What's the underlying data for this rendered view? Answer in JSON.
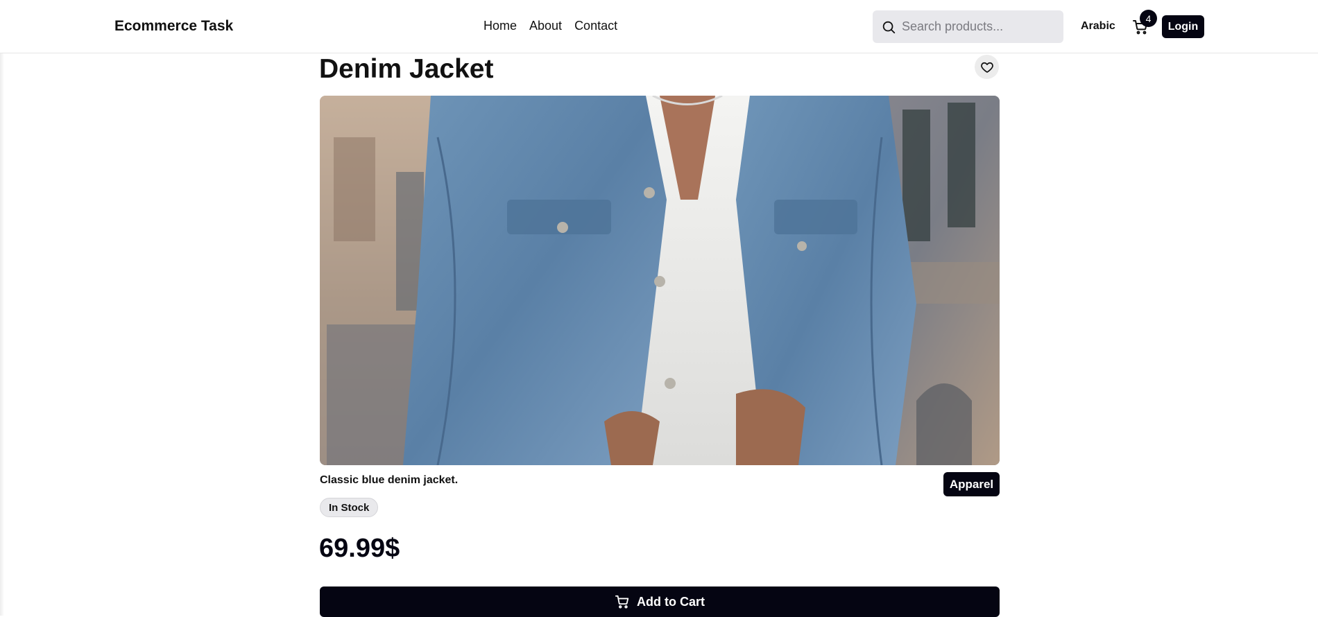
{
  "header": {
    "brand": "Ecommerce Task",
    "nav": [
      "Home",
      "About",
      "Contact"
    ],
    "search_placeholder": "Search products...",
    "language": "Arabic",
    "cart_count": "4",
    "login_label": "Login"
  },
  "product": {
    "name": "Denim Jacket",
    "description": "Classic blue denim jacket.",
    "category": "Apparel",
    "stock_status": "In Stock",
    "price": "69.99$",
    "add_to_cart_label": "Add to Cart",
    "image_subject": "man wearing a blue denim jacket over a white shirt"
  },
  "icons": {
    "search": "search-icon",
    "cart": "cart-icon",
    "favorite": "heart-icon"
  },
  "colors": {
    "primary": "#050512",
    "search_bg": "#e8e8ec",
    "badge_bg": "#e9e9ec"
  }
}
